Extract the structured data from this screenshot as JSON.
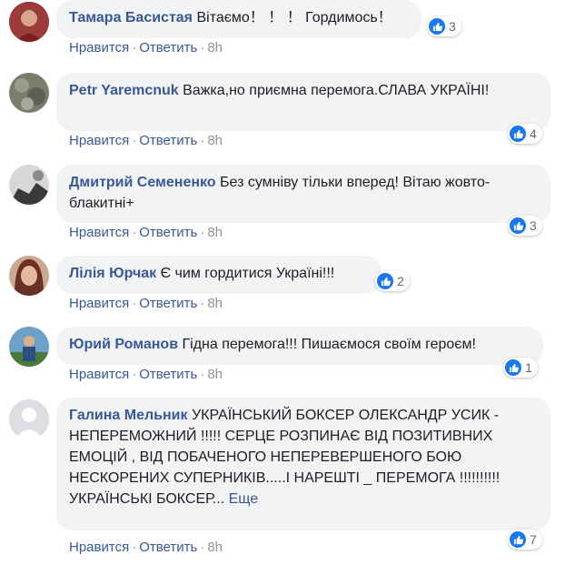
{
  "comments": [
    {
      "author": "Тамара Басистая",
      "text": "Вітаємо！ ！ ！ Гордимось！",
      "likes": "3",
      "like_label": "Нравится",
      "reply_label": "Ответить",
      "time": "8h"
    },
    {
      "author": "Petr Yaremcnuk",
      "text": "Важка,но приємна перемога.СЛАВА УКРАЇНІ!",
      "likes": "4",
      "like_label": "Нравится",
      "reply_label": "Ответить",
      "time": "8h"
    },
    {
      "author": "Дмитрий Семененко",
      "text": "Без сумніву тільки вперед! Вітаю жовто-блакитні+",
      "likes": "3",
      "like_label": "Нравится",
      "reply_label": "Ответить",
      "time": "8h"
    },
    {
      "author": "Лілія Юрчак",
      "text": "Є чим гордитися Україні!!!",
      "likes": "2",
      "like_label": "Нравится",
      "reply_label": "Ответить",
      "time": "8h"
    },
    {
      "author": "Юрий Романов",
      "text": "Гідна перемога!!! Пишаємося своїм героєм!",
      "likes": "1",
      "like_label": "Нравится",
      "reply_label": "Ответить",
      "time": "8h"
    },
    {
      "author": "Галина Мельник",
      "text": "УКРАЇНСЬКИЙ БОКСЕР ОЛЕКСАНДР УСИК - НЕПЕРЕМОЖНИЙ !!!!! СЕРЦЕ РОЗПИНАЄ ВІД ПОЗИТИВНИХ ЕМОЦІЙ , ВІД ПОБАЧЕНОГО НЕПЕРЕВЕРШЕНОГО БОЮ НЕСКОРЕНИХ СУПЕРНИКІВ.....І НАРЕШТІ _ ПЕРЕМОГА !!!!!!!!!!УКРАЇНСЬКІ БОКСЕР...",
      "more_label": "Еще",
      "likes": "7",
      "like_label": "Нравится",
      "reply_label": "Ответить",
      "time": "8h"
    }
  ],
  "separator": "·",
  "colors": {
    "author": "#385898",
    "bubble": "#f2f3f5",
    "like": "#1877f2",
    "meta": "#90949c"
  },
  "icons": {
    "like": "thumbs-up-icon"
  }
}
